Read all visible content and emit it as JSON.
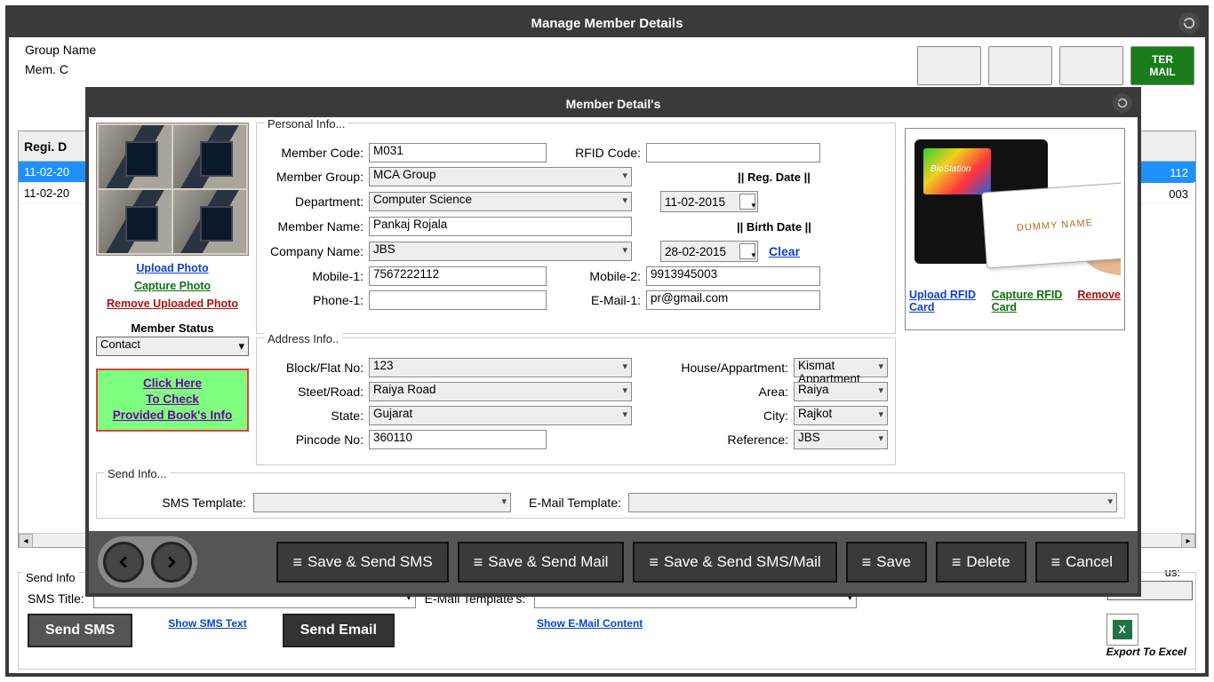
{
  "main": {
    "title": "Manage Member Details",
    "group_name_label": "Group Name",
    "mem_c_label": "Mem. C",
    "filter_email_label_line1": "TER",
    "filter_email_label_line2": "MAIL"
  },
  "bgTable": {
    "head": "Regi. D",
    "rows": [
      "11-02-20",
      "11-02-20"
    ],
    "right_head": "",
    "right_rows": [
      "112",
      "003"
    ]
  },
  "bgSend": {
    "legend": "Send Info",
    "sms_title_label": "SMS Title:",
    "email_template_label": "E-Mail Template's:",
    "send_sms": "Send SMS",
    "send_email": "Send Email",
    "show_sms": "Show SMS Text",
    "show_email": "Show E-Mail Content",
    "pw_status": "us:",
    "export_label": "Export To Excel"
  },
  "dialog": {
    "title": "Member Detail's",
    "left": {
      "upload_photo": "Upload Photo",
      "capture_photo": "Capture Photo",
      "remove_photo": "Remove Uploaded Photo",
      "status_label": "Member Status",
      "status_value": "Contact",
      "green_box": "Click Here\nTo Check\nProvided Book's Info"
    },
    "personal": {
      "legend": "Personal Info...",
      "member_code_label": "Member Code:",
      "member_code": "M031",
      "rfid_label": "RFID Code:",
      "rfid": "",
      "group_label": "Member Group:",
      "group": "MCA Group",
      "dept_label": "Department:",
      "dept": "Computer Science",
      "reg_date_head": "|| Reg. Date ||",
      "reg_date": "11-02-2015",
      "name_label": "Member Name:",
      "name": "Pankaj Rojala",
      "birth_date_head": "|| Birth Date ||",
      "birth_date": "28-02-2015",
      "company_label": "Company Name:",
      "company": "JBS",
      "clear": "Clear",
      "mobile1_label": "Mobile-1:",
      "mobile1": "7567222112",
      "mobile2_label": "Mobile-2:",
      "mobile2": "9913945003",
      "phone1_label": "Phone-1:",
      "phone1": "",
      "email1_label": "E-Mail-1:",
      "email1": "pr@gmail.com"
    },
    "address": {
      "legend": "Address Info..",
      "block_label": "Block/Flat No:",
      "block": "123",
      "house_label": "House/Appartment:",
      "house": "Kismat Appartment",
      "street_label": "Steet/Road:",
      "street": "Raiya Road",
      "area_label": "Area:",
      "area": "Raiya",
      "state_label": "State:",
      "state": "Gujarat",
      "city_label": "City:",
      "city": "Rajkot",
      "pincode_label": "Pincode No:",
      "pincode": "360110",
      "reference_label": "Reference:",
      "reference": "JBS"
    },
    "rfid": {
      "card_text": "DUMMY NAME",
      "upload": "Upload RFID Card",
      "capture": "Capture RFID Card",
      "remove": "Remove"
    },
    "sendInfo": {
      "legend": "Send Info...",
      "sms_template_label": "SMS Template:",
      "sms_template": "",
      "email_template_label": "E-Mail Template:",
      "email_template": ""
    },
    "footer": {
      "save_sms": "Save & Send SMS",
      "save_mail": "Save & Send Mail",
      "save_both": "Save & Send SMS/Mail",
      "save": "Save",
      "delete": "Delete",
      "cancel": "Cancel"
    }
  }
}
